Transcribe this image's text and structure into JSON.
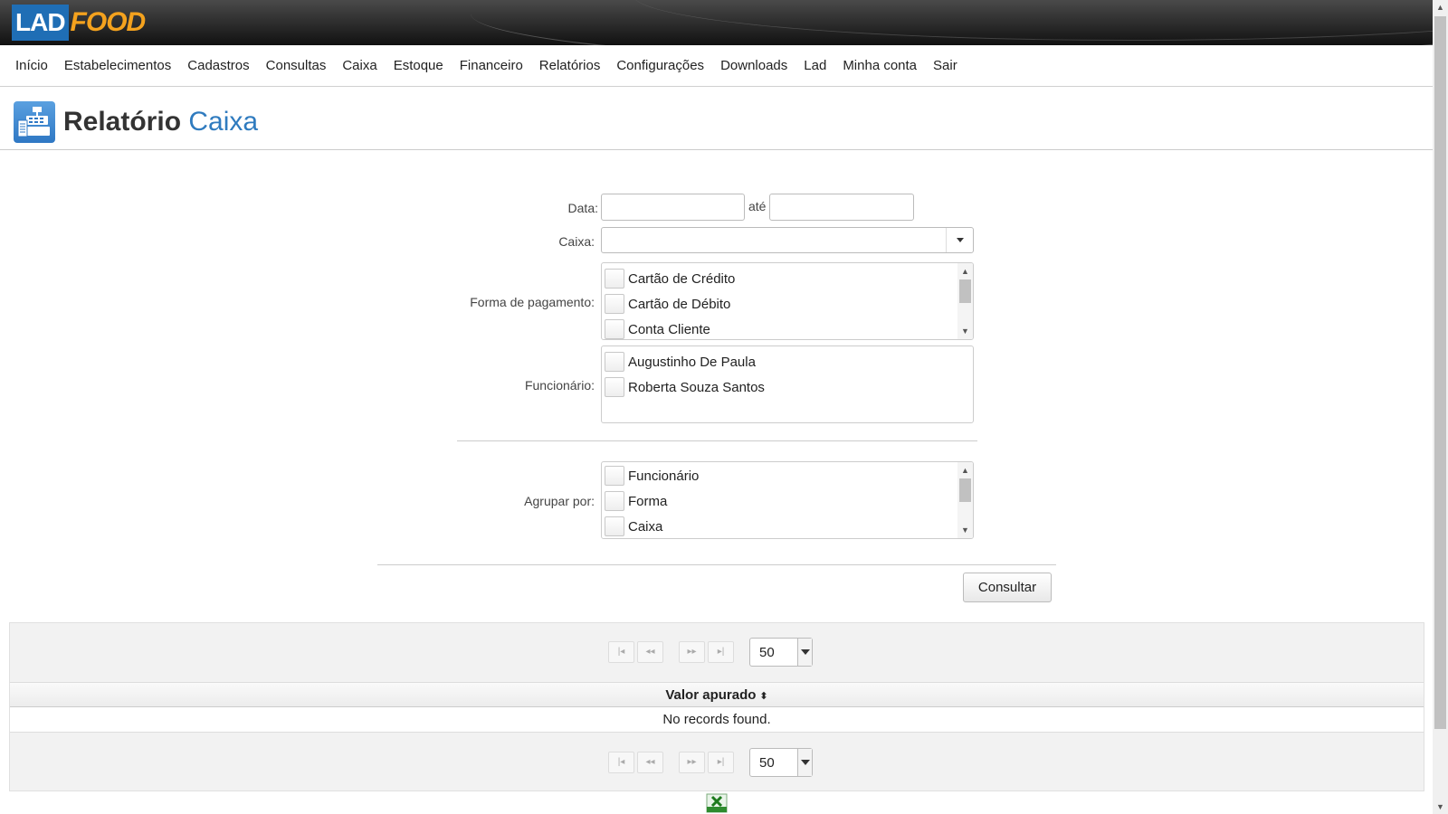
{
  "logo": {
    "part1": "LAD",
    "part2": "FOOD"
  },
  "menu": [
    "Início",
    "Estabelecimentos",
    "Cadastros",
    "Consultas",
    "Caixa",
    "Estoque",
    "Financeiro",
    "Relatórios",
    "Configurações",
    "Downloads",
    "Lad",
    "Minha conta",
    "Sair"
  ],
  "page": {
    "title_main": "Relatório",
    "title_accent": "Caixa",
    "icon": "cash-register-icon"
  },
  "form": {
    "date_label": "Data:",
    "date_from": "",
    "date_sep": "até",
    "date_to": "",
    "caixa_label": "Caixa:",
    "caixa_value": "",
    "payment_label": "Forma de pagamento:",
    "payment_options": [
      "Cartão de Crédito",
      "Cartão de Débito",
      "Conta Cliente"
    ],
    "employee_label": "Funcionário:",
    "employee_options": [
      "Augustinho De Paula",
      "Roberta Souza Santos"
    ],
    "group_label": "Agrupar por:",
    "group_options": [
      "Funcionário",
      "Forma",
      "Caixa"
    ],
    "submit_label": "Consultar"
  },
  "table": {
    "rows_per_page": "50",
    "column_header": "Valor apurado",
    "empty_message": "No records found."
  },
  "colors": {
    "accent": "#2f7bbf",
    "logo_blue": "#1f6eb5",
    "logo_orange": "#f4a21e"
  }
}
